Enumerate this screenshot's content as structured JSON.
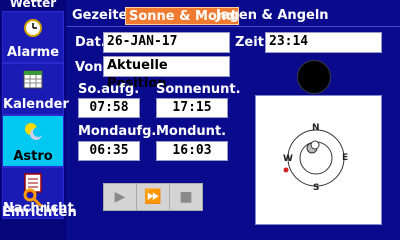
{
  "sidebar": {
    "title": "Wetter",
    "items": [
      {
        "label": "Alarme",
        "icon": "alarm-clock-icon",
        "active": false
      },
      {
        "label": "Kalender",
        "icon": "calendar-icon",
        "active": false
      },
      {
        "label": "Astro",
        "icon": "sun-moon-icon",
        "active": true
      },
      {
        "label": "Nachricht",
        "icon": "message-icon",
        "active": false
      },
      {
        "label": "Einrichten",
        "icon": "wrench-icon",
        "active": false
      }
    ]
  },
  "tabs": [
    {
      "label": "Gezeiten",
      "active": false
    },
    {
      "label": "Sonne & Mond",
      "active": true
    },
    {
      "label": "Jagen & Angeln",
      "active": false
    }
  ],
  "fields": {
    "date_label": "Dat.",
    "date_value": "26-JAN-17",
    "time_label": "Zeit",
    "time_value": "23:14",
    "from_label": "Von",
    "from_value": "Aktuelle Position"
  },
  "sun": {
    "rise_label": "So.aufg.",
    "rise_value": "07:58",
    "set_label": "Sonnenunt.",
    "set_value": "17:15"
  },
  "moon": {
    "rise_label": "Mondaufg.",
    "rise_value": "06:35",
    "set_label": "Mondunt.",
    "set_value": "16:03"
  },
  "compass": {
    "n": "N",
    "e": "E",
    "s": "S",
    "w": "W"
  },
  "media": {
    "play": "▶",
    "fast_forward": "⏩",
    "stop": "■"
  },
  "colors": {
    "active_tab": "#f07a30",
    "active_sidebar": "#00c8f0",
    "background": "#0a0a8c"
  }
}
